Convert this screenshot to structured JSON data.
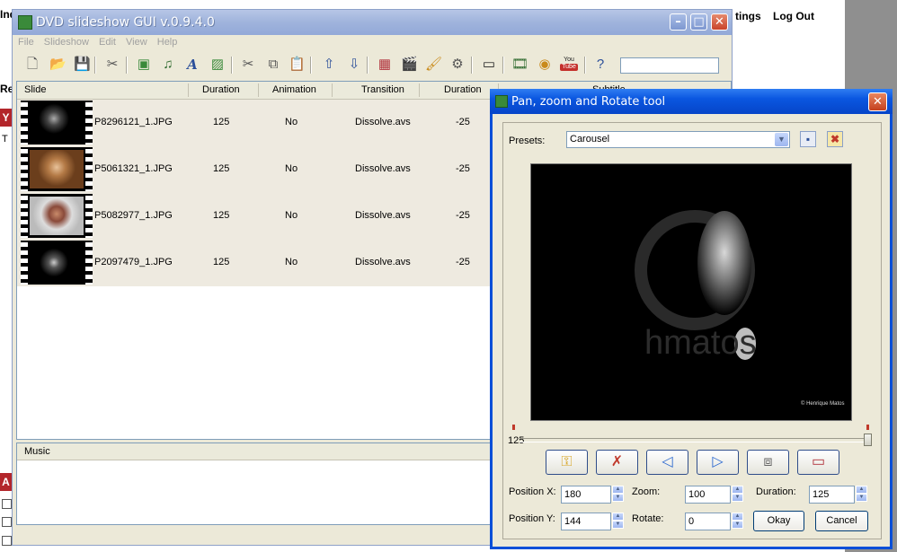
{
  "background_page": {
    "links": [
      "tings",
      "Log Out"
    ],
    "left_fragments": [
      "Ind",
      "Re",
      "Y",
      "T",
      "A"
    ]
  },
  "main_window": {
    "title": "DVD slideshow GUI v.0.9.4.0",
    "menu": [
      "File",
      "Slideshow",
      "Edit",
      "View",
      "Help"
    ],
    "toolbar_icons": [
      "new-icon",
      "open-icon",
      "save-icon",
      "tools-icon",
      "add-slide-icon",
      "music-icon",
      "text-icon",
      "image-icon",
      "cut-icon",
      "copy-icon",
      "paste-icon",
      "move-up-icon",
      "move-down-icon",
      "picture-icon",
      "clapper-icon",
      "brush-icon",
      "export-icon",
      "slideshow-icon",
      "film-icon",
      "disc-icon",
      "youtube-icon",
      "help-icon"
    ],
    "youtube_label_top": "You",
    "youtube_label_bottom": "Tube",
    "search_value": "",
    "columns": [
      "Slide",
      "Duration",
      "Animation",
      "Transition",
      "Duration",
      "Subtitle"
    ],
    "slides": [
      {
        "file": "P8296121_1.JPG",
        "duration": "125",
        "animation": "No",
        "transition": "Dissolve.avs",
        "transition_duration": "-25"
      },
      {
        "file": "P5061321_1.JPG",
        "duration": "125",
        "animation": "No",
        "transition": "Dissolve.avs",
        "transition_duration": "-25"
      },
      {
        "file": "P5082977_1.JPG",
        "duration": "125",
        "animation": "No",
        "transition": "Dissolve.avs",
        "transition_duration": "-25"
      },
      {
        "file": "P2097479_1.JPG",
        "duration": "125",
        "animation": "No",
        "transition": "Dissolve.avs",
        "transition_duration": "-25"
      }
    ],
    "music_header": "Music"
  },
  "dialog": {
    "title": "Pan, zoom and Rotate tool",
    "presets_label": "Presets:",
    "presets_value": "Carousel",
    "slider_value": "125",
    "watermark_text": "hmatos",
    "credit_text": "© Henrique Matos",
    "buttons": [
      "key-icon",
      "delete-key-icon",
      "previous-icon",
      "next-icon",
      "fit-icon",
      "full-frame-icon"
    ],
    "position_x_label": "Position X:",
    "position_x": "180",
    "position_y_label": "Position Y:",
    "position_y": "144",
    "zoom_label": "Zoom:",
    "zoom": "100",
    "rotate_label": "Rotate:",
    "rotate": "0",
    "duration_label": "Duration:",
    "duration": "125",
    "okay": "Okay",
    "cancel": "Cancel"
  },
  "colors": {
    "dialog_title": "#0a56e0",
    "main_title": "#9fb3dc",
    "list_row": "#eeeae0"
  }
}
